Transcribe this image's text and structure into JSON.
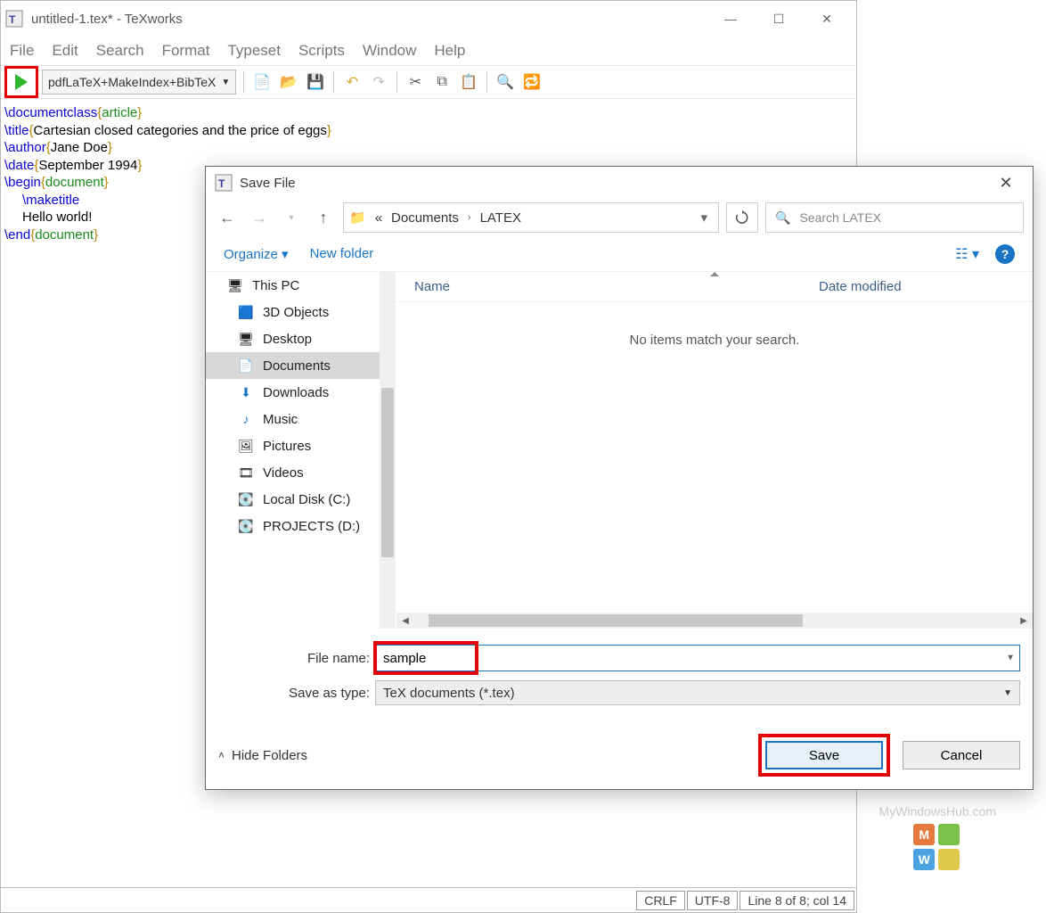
{
  "texworks": {
    "title": "untitled-1.tex* - TeXworks",
    "menus": [
      "File",
      "Edit",
      "Search",
      "Format",
      "Typeset",
      "Scripts",
      "Window",
      "Help"
    ],
    "engine": "pdfLaTeX+MakeIndex+BibTeX",
    "code": {
      "l1_cmd": "\\documentclass",
      "l1_arg": "article",
      "l2_cmd": "\\title",
      "l2_plain": "Cartesian closed categories and the price of eggs",
      "l3_cmd": "\\author",
      "l3_plain": "Jane Doe",
      "l4_cmd": "\\date",
      "l4_plain": "September 1994",
      "l5_cmd": "\\begin",
      "l5_arg": "document",
      "l6_cmd": "\\maketitle",
      "l7_plain": "Hello world!",
      "l8_cmd": "\\end",
      "l8_arg": "document"
    },
    "status": {
      "crlf": "CRLF",
      "enc": "UTF-8",
      "pos": "Line 8 of 8; col 14"
    }
  },
  "savedlg": {
    "title": "Save File",
    "breadcrumb": {
      "ellipsis": "«",
      "p1": "Documents",
      "p2": "LATEX"
    },
    "search_placeholder": "Search LATEX",
    "organize": "Organize",
    "newfolder": "New folder",
    "tree": {
      "root": "This PC",
      "items": [
        "3D Objects",
        "Desktop",
        "Documents",
        "Downloads",
        "Music",
        "Pictures",
        "Videos",
        "Local Disk (C:)",
        "PROJECTS (D:)"
      ]
    },
    "columns": {
      "name": "Name",
      "date": "Date modified"
    },
    "empty": "No items match your search.",
    "fields": {
      "fn_label": "File name:",
      "fn_value": "sample",
      "type_label": "Save as type:",
      "type_value": "TeX documents (*.tex)"
    },
    "hide_folders": "Hide Folders",
    "save": "Save",
    "cancel": "Cancel"
  },
  "watermark": "MyWindowsHub.com"
}
